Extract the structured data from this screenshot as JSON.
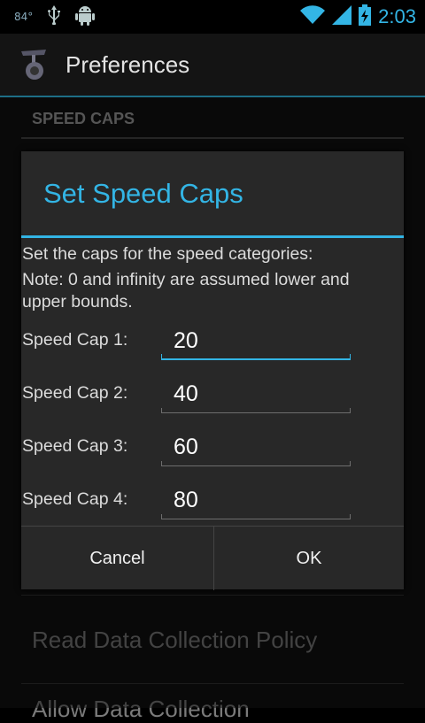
{
  "status_bar": {
    "temperature": "84°",
    "time": "2:03",
    "icons": [
      "usb-icon",
      "android-debug-icon",
      "wifi-icon",
      "signal-icon",
      "battery-charging-icon"
    ]
  },
  "action_bar": {
    "title": "Preferences",
    "app_icon": "app-logo-icon"
  },
  "preferences": {
    "category": "SPEED CAPS",
    "items": [
      "Read Data Collection Policy",
      "Allow Data Collection"
    ]
  },
  "dialog": {
    "title": "Set Speed Caps",
    "message_1": "Set the caps for the speed categories:",
    "message_2": "Note: 0 and infinity are assumed lower and upper bounds.",
    "caps": [
      {
        "label": "Speed Cap 1:",
        "value": "20",
        "focused": true
      },
      {
        "label": "Speed Cap 2:",
        "value": "40",
        "focused": false
      },
      {
        "label": "Speed Cap 3:",
        "value": "60",
        "focused": false
      },
      {
        "label": "Speed Cap 4:",
        "value": "80",
        "focused": false
      }
    ],
    "cancel_label": "Cancel",
    "ok_label": "OK"
  },
  "colors": {
    "accent": "#33b5e5",
    "dialog_bg": "#282828",
    "background": "#111111"
  }
}
